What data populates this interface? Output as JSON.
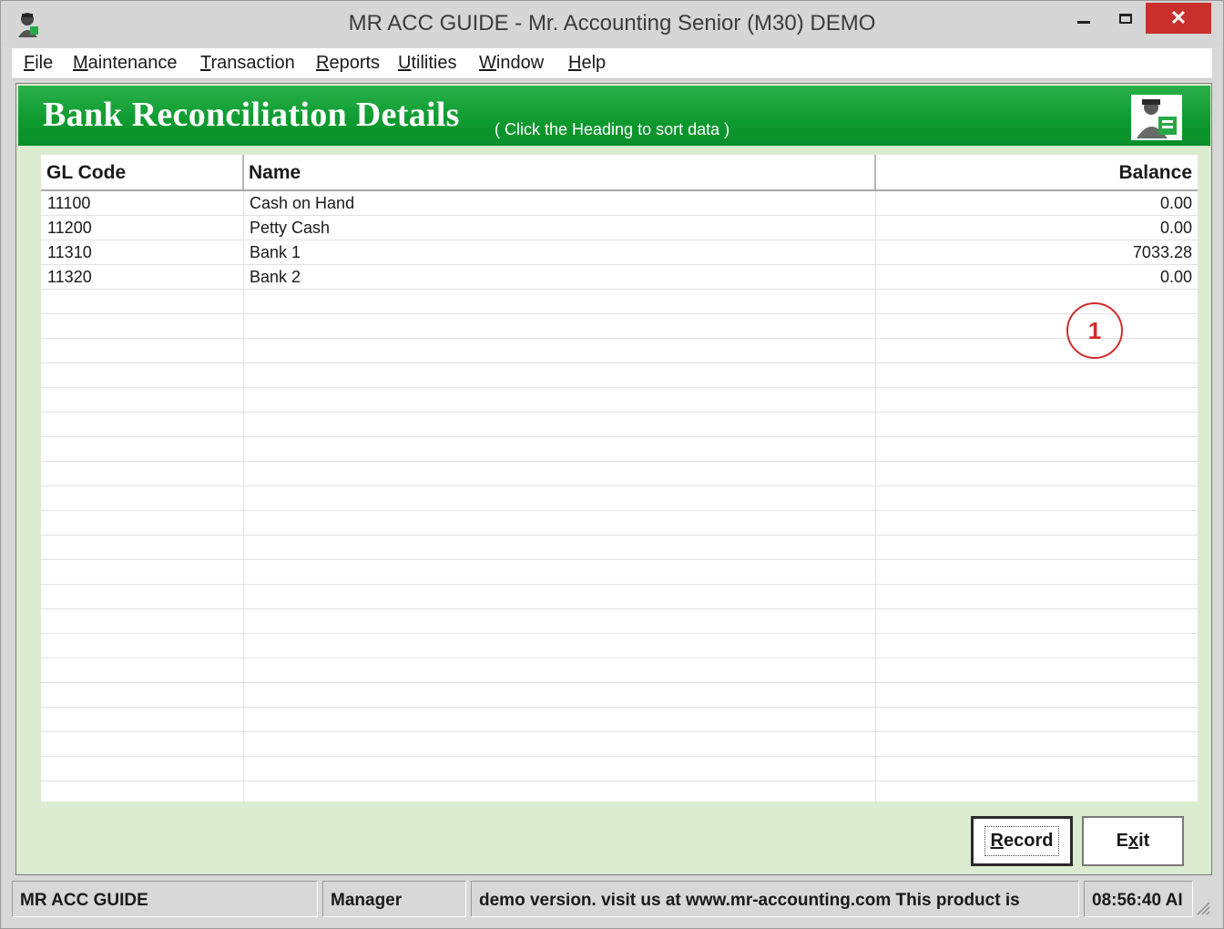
{
  "window": {
    "title": "MR ACC GUIDE - Mr. Accounting Senior (M30) DEMO",
    "icon": "user-badge-icon",
    "controls": {
      "minimize": "minimize-icon",
      "maximize": "maximize-icon",
      "close": "✕"
    }
  },
  "menu": [
    {
      "underline": "F",
      "rest": "ile"
    },
    {
      "underline": "M",
      "rest": "aintenance"
    },
    {
      "underline": "T",
      "rest": "ransaction"
    },
    {
      "underline": "R",
      "rest": "eports"
    },
    {
      "underline": "U",
      "rest": "tilities"
    },
    {
      "underline": "W",
      "rest": "indow"
    },
    {
      "underline": "H",
      "rest": "elp"
    }
  ],
  "banner": {
    "title": "Bank Reconciliation Details",
    "subtitle": "( Click the Heading to sort data )",
    "icon": "accountant-figure-icon"
  },
  "grid": {
    "headers": {
      "code": "GL Code",
      "name": "Name",
      "balance": "Balance"
    },
    "rows": [
      {
        "code": "11100",
        "name": "Cash on Hand",
        "balance": "0.00"
      },
      {
        "code": "11200",
        "name": "Petty Cash",
        "balance": "0.00"
      },
      {
        "code": "11310",
        "name": "Bank 1",
        "balance": "7033.28"
      },
      {
        "code": "11320",
        "name": "Bank 2",
        "balance": "0.00"
      }
    ],
    "marker": "1"
  },
  "buttons": {
    "record": {
      "underline": "R",
      "rest": "ecord"
    },
    "exit": {
      "pre": "E",
      "underline": "x",
      "rest": "it"
    }
  },
  "status": {
    "app": "MR ACC GUIDE",
    "user": "Manager",
    "message": "demo version.  visit us at www.mr-accounting.com This product is",
    "time": "08:56:40 AI"
  },
  "colors": {
    "banner": "#0c9a2f",
    "client": "#dbecd0",
    "close": "#c9302c",
    "marker": "#d22a2a"
  }
}
